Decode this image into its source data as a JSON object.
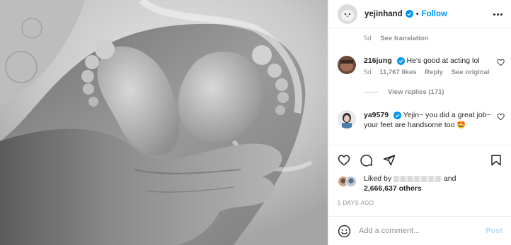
{
  "post": {
    "author": {
      "username": "yejinhand",
      "verified": true,
      "follow_label": "Follow",
      "separator": "•"
    },
    "caption_meta": {
      "age": "5d",
      "translation_label": "See translation"
    },
    "comments": [
      {
        "username": "216jung",
        "verified": true,
        "text": "He's good at acting lol",
        "age": "5d",
        "likes": "11,767 likes",
        "reply_label": "Reply",
        "original_label": "See original"
      },
      {
        "username": "ya9579",
        "verified": true,
        "text": "Yejin~ you did a great job~ your feet are handsome too 🤩"
      }
    ],
    "view_replies_label": "View replies (171)",
    "likes": {
      "prefix": "Liked by",
      "conjunction": "and",
      "count": "2,666,637 others"
    },
    "time_ago": "5 DAYS AGO",
    "comment_box": {
      "placeholder": "Add a comment...",
      "post_label": "Post"
    },
    "icons": {
      "more": "more-options-icon",
      "like": "heart-icon",
      "comment": "comment-bubble-icon",
      "share": "paper-plane-icon",
      "save": "bookmark-icon",
      "emoji": "smiley-icon",
      "verified": "verified-badge-icon"
    },
    "colors": {
      "accent": "#0095f6",
      "post_disabled": "#b2dffc",
      "muted": "#8e8e8e",
      "text": "#262626"
    }
  }
}
